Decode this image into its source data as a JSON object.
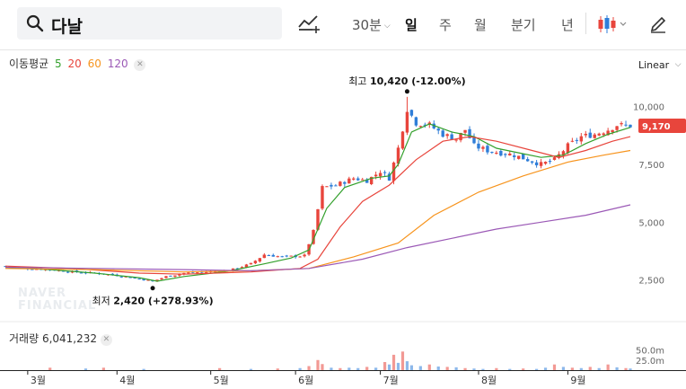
{
  "search": {
    "query": "다날"
  },
  "toolbar": {
    "interval_label": "30분",
    "periods": [
      "일",
      "주",
      "월",
      "분기",
      "년"
    ],
    "active_period": "일"
  },
  "ma_legend": {
    "label": "이동평균",
    "periods": [
      {
        "label": "5",
        "color": "#33a02c"
      },
      {
        "label": "20",
        "color": "#e8453c"
      },
      {
        "label": "60",
        "color": "#f7941d"
      },
      {
        "label": "120",
        "color": "#9b59b6"
      }
    ]
  },
  "scale_mode": "Linear",
  "volume_legend": {
    "label": "거래량",
    "value": "6,041,232"
  },
  "chart_data": {
    "type": "candlestick",
    "title": "",
    "price_axis": {
      "ticks": [
        "10,000",
        "7,500",
        "5,000",
        "2,500"
      ],
      "tick_values": [
        10000,
        7500,
        5000,
        2500
      ],
      "range": [
        1400,
        11500
      ]
    },
    "volume_axis": {
      "ticks": [
        "50.0m",
        "25.0m"
      ]
    },
    "x_ticks": [
      {
        "label": "3월",
        "index": 5
      },
      {
        "label": "4월",
        "index": 25
      },
      {
        "label": "5월",
        "index": 46
      },
      {
        "label": "6월",
        "index": 65
      },
      {
        "label": "7월",
        "index": 84
      },
      {
        "label": "8월",
        "index": 106
      },
      {
        "label": "9월",
        "index": 126
      }
    ],
    "current_price": {
      "label": "9,170",
      "value": 9170
    },
    "annotations": {
      "high": {
        "prefix": "최고",
        "value": "10,420",
        "change": "(-12.00%)",
        "index": 90,
        "price": 10420
      },
      "low": {
        "prefix": "최저",
        "value": "2,420",
        "change": "(+278.93%)",
        "index": 33,
        "price": 2420
      }
    },
    "close_points": [
      [
        0,
        3100
      ],
      [
        5,
        3000
      ],
      [
        10,
        2950
      ],
      [
        15,
        2850
      ],
      [
        20,
        2800
      ],
      [
        25,
        2700
      ],
      [
        30,
        2550
      ],
      [
        33,
        2450
      ],
      [
        36,
        2650
      ],
      [
        40,
        2800
      ],
      [
        45,
        2850
      ],
      [
        50,
        2900
      ],
      [
        55,
        3200
      ],
      [
        58,
        3600
      ],
      [
        62,
        3500
      ],
      [
        67,
        3550
      ],
      [
        69,
        4600
      ],
      [
        71,
        6500
      ],
      [
        74,
        6600
      ],
      [
        78,
        6900
      ],
      [
        81,
        6800
      ],
      [
        84,
        7200
      ],
      [
        86,
        6900
      ],
      [
        88,
        8200
      ],
      [
        90,
        9900
      ],
      [
        92,
        9300
      ],
      [
        95,
        9200
      ],
      [
        98,
        8800
      ],
      [
        101,
        8600
      ],
      [
        103,
        9000
      ],
      [
        105,
        8300
      ],
      [
        108,
        8100
      ],
      [
        111,
        8000
      ],
      [
        114,
        7900
      ],
      [
        117,
        7700
      ],
      [
        120,
        7500
      ],
      [
        123,
        7700
      ],
      [
        126,
        8300
      ],
      [
        129,
        8700
      ],
      [
        132,
        8800
      ],
      [
        135,
        9000
      ],
      [
        137,
        9200
      ],
      [
        140,
        9170
      ]
    ],
    "ma_series": [
      {
        "name": "5",
        "color": "#33a02c",
        "points": [
          [
            0,
            3050
          ],
          [
            10,
            2950
          ],
          [
            20,
            2800
          ],
          [
            30,
            2600
          ],
          [
            34,
            2450
          ],
          [
            40,
            2650
          ],
          [
            50,
            2880
          ],
          [
            58,
            3200
          ],
          [
            64,
            3450
          ],
          [
            68,
            3800
          ],
          [
            72,
            5600
          ],
          [
            76,
            6500
          ],
          [
            82,
            6900
          ],
          [
            86,
            7000
          ],
          [
            88,
            7500
          ],
          [
            91,
            8900
          ],
          [
            95,
            9250
          ],
          [
            100,
            8900
          ],
          [
            105,
            8700
          ],
          [
            110,
            8200
          ],
          [
            115,
            8000
          ],
          [
            120,
            7800
          ],
          [
            125,
            7900
          ],
          [
            130,
            8400
          ],
          [
            135,
            8800
          ],
          [
            140,
            9100
          ]
        ]
      },
      {
        "name": "20",
        "color": "#e8453c",
        "points": [
          [
            0,
            3100
          ],
          [
            15,
            3000
          ],
          [
            30,
            2800
          ],
          [
            40,
            2750
          ],
          [
            55,
            2850
          ],
          [
            66,
            3000
          ],
          [
            70,
            3400
          ],
          [
            75,
            4800
          ],
          [
            80,
            5900
          ],
          [
            86,
            6600
          ],
          [
            92,
            7700
          ],
          [
            98,
            8500
          ],
          [
            104,
            8700
          ],
          [
            110,
            8500
          ],
          [
            118,
            8100
          ],
          [
            124,
            7800
          ],
          [
            130,
            8100
          ],
          [
            136,
            8500
          ],
          [
            140,
            8700
          ]
        ]
      },
      {
        "name": "60",
        "color": "#f7941d",
        "points": [
          [
            0,
            3000
          ],
          [
            20,
            2950
          ],
          [
            40,
            2850
          ],
          [
            55,
            2900
          ],
          [
            68,
            3000
          ],
          [
            78,
            3500
          ],
          [
            88,
            4100
          ],
          [
            96,
            5300
          ],
          [
            106,
            6300
          ],
          [
            116,
            7000
          ],
          [
            126,
            7600
          ],
          [
            134,
            7900
          ],
          [
            140,
            8100
          ]
        ]
      },
      {
        "name": "120",
        "color": "#9b59b6",
        "points": [
          [
            0,
            3050
          ],
          [
            20,
            3000
          ],
          [
            40,
            2950
          ],
          [
            55,
            2900
          ],
          [
            68,
            3000
          ],
          [
            80,
            3400
          ],
          [
            90,
            3900
          ],
          [
            100,
            4300
          ],
          [
            110,
            4700
          ],
          [
            120,
            5000
          ],
          [
            130,
            5300
          ],
          [
            140,
            5750
          ]
        ]
      }
    ],
    "volume_bars": [
      [
        10,
        6,
        "#e8453c"
      ],
      [
        18,
        4,
        "#2f7ed8"
      ],
      [
        22,
        6,
        "#e8453c"
      ],
      [
        31,
        3,
        "#2f7ed8"
      ],
      [
        48,
        5,
        "#e8453c"
      ],
      [
        55,
        3,
        "#2f7ed8"
      ],
      [
        61,
        4,
        "#e8453c"
      ],
      [
        66,
        5,
        "#2f7ed8"
      ],
      [
        68,
        10,
        "#e8453c"
      ],
      [
        70,
        25,
        "#e8453c"
      ],
      [
        71,
        15,
        "#e8453c"
      ],
      [
        73,
        6,
        "#2f7ed8"
      ],
      [
        75,
        5,
        "#e8453c"
      ],
      [
        77,
        6,
        "#2f7ed8"
      ],
      [
        79,
        5,
        "#2f7ed8"
      ],
      [
        81,
        8,
        "#e8453c"
      ],
      [
        83,
        6,
        "#2f7ed8"
      ],
      [
        85,
        20,
        "#e8453c"
      ],
      [
        86,
        14,
        "#2f7ed8"
      ],
      [
        87,
        38,
        "#e8453c"
      ],
      [
        88,
        18,
        "#2f7ed8"
      ],
      [
        89,
        46,
        "#e8453c"
      ],
      [
        90,
        22,
        "#2f7ed8"
      ],
      [
        91,
        12,
        "#2f7ed8"
      ],
      [
        93,
        10,
        "#2f7ed8"
      ],
      [
        95,
        14,
        "#e8453c"
      ],
      [
        97,
        9,
        "#2f7ed8"
      ],
      [
        99,
        8,
        "#e8453c"
      ],
      [
        101,
        7,
        "#2f7ed8"
      ],
      [
        103,
        5,
        "#e8453c"
      ],
      [
        105,
        4,
        "#2f7ed8"
      ],
      [
        107,
        3,
        "#2f7ed8"
      ],
      [
        110,
        5,
        "#e8453c"
      ],
      [
        113,
        3,
        "#2f7ed8"
      ],
      [
        116,
        4,
        "#e8453c"
      ],
      [
        119,
        3,
        "#2f7ed8"
      ],
      [
        121,
        6,
        "#2f7ed8"
      ],
      [
        123,
        14,
        "#e8453c"
      ],
      [
        125,
        8,
        "#2f7ed8"
      ],
      [
        127,
        6,
        "#e8453c"
      ],
      [
        129,
        5,
        "#2f7ed8"
      ],
      [
        131,
        8,
        "#e8453c"
      ],
      [
        133,
        5,
        "#2f7ed8"
      ],
      [
        135,
        14,
        "#e8453c"
      ],
      [
        137,
        7,
        "#2f7ed8"
      ],
      [
        139,
        5,
        "#e8453c"
      ],
      [
        140,
        4,
        "#2f7ed8"
      ]
    ],
    "watermark": "NAVER FINANCIAL",
    "up_color": "#e8453c",
    "down_color": "#2f7ed8"
  }
}
